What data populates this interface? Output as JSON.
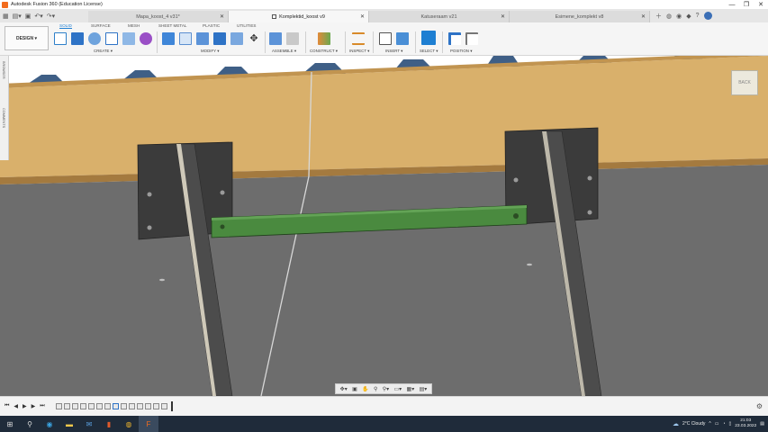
{
  "window": {
    "title": "Autodesk Fusion 360 (Education License)",
    "minimize": "—",
    "maximize": "❐",
    "close": "✕"
  },
  "tabs": [
    {
      "label": "Mapa_koost_4 v31*",
      "active": false
    },
    {
      "label": "Komplektid_koost v9",
      "active": true
    },
    {
      "label": "Katuseraam v21",
      "active": false
    },
    {
      "label": "Esimene_komplekt v8",
      "active": false
    }
  ],
  "toolbar": {
    "workspace": "DESIGN",
    "workspace_tabs": [
      "SOLID",
      "SURFACE",
      "MESH",
      "SHEET METAL",
      "PLASTIC",
      "UTILITIES"
    ],
    "groups": {
      "create": "CREATE",
      "modify": "MODIFY",
      "assemble": "ASSEMBLE",
      "construct": "CONSTRUCT",
      "inspect": "INSPECT",
      "insert": "INSERT",
      "select": "SELECT",
      "position": "POSITION"
    }
  },
  "side_panel": {
    "browser": "BROWSER",
    "comments": "COMMENTS"
  },
  "viewcube": {
    "label": "BACK"
  },
  "taskbar": {
    "weather": "2°C  Cloudy",
    "time": "21:03",
    "date": "23.03.2022"
  },
  "colors": {
    "wall": "#d9b06b",
    "floor": "#6d6d6d",
    "bracket": "#3b3b3b",
    "green_bar": "#4a8a3f",
    "accent": "#1e7fd2"
  }
}
